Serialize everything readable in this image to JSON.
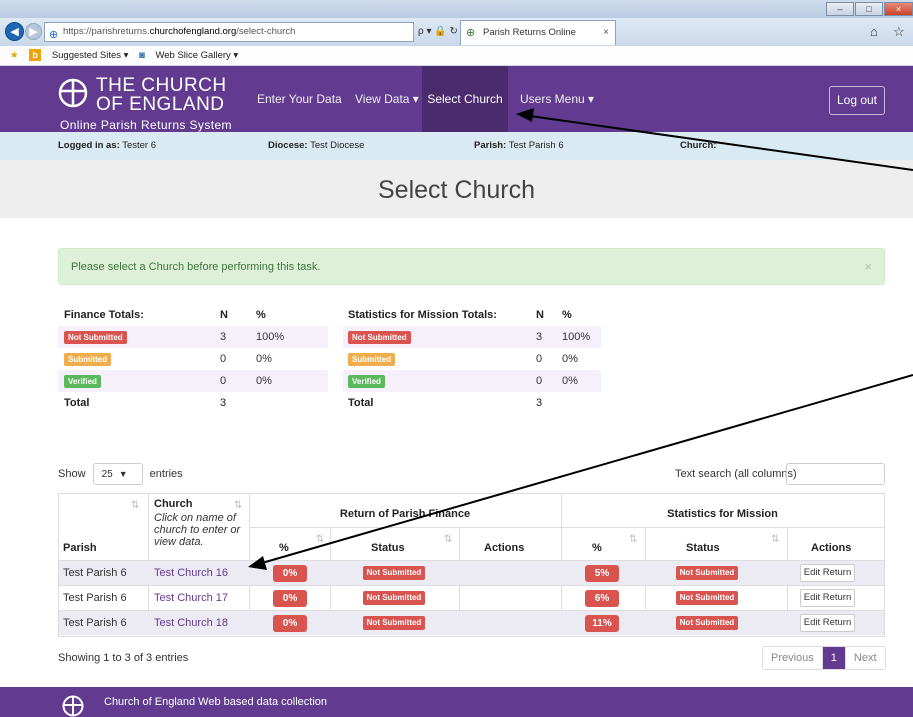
{
  "browser": {
    "url_prefix": "https://parishreturns.",
    "url_domain": "churchofengland.org",
    "url_path": "/select-church",
    "tab_title": "Parish Returns Online",
    "tab_close": "×",
    "address_icons": "ρ ▾ 🔒 ↻",
    "favorites": {
      "suggested": "Suggested Sites ▾",
      "web_slice": "Web Slice Gallery ▾"
    }
  },
  "header": {
    "logo_line1": "THE CHURCH",
    "logo_line2": "OF ENGLAND",
    "logo_sub": "Online Parish Returns System",
    "nav": [
      {
        "label": "Enter Your Data"
      },
      {
        "label": "View Data ▾"
      },
      {
        "label": "Select Church"
      },
      {
        "label": "Users Menu ▾"
      }
    ],
    "logout": "Log out"
  },
  "infobar": {
    "logged_label": "Logged in as:",
    "logged_value": "Tester 6",
    "diocese_label": "Diocese:",
    "diocese_value": "Test Diocese",
    "parish_label": "Parish:",
    "parish_value": "Test Parish 6",
    "church_label": "Church:"
  },
  "page_title": "Select Church",
  "alert": {
    "text": "Please select a Church before performing this task.",
    "close": "×"
  },
  "finance_totals": {
    "title": "Finance Totals:",
    "n_header": "N",
    "pct_header": "%",
    "rows": [
      {
        "status": "Not Submitted",
        "n": "3",
        "pct": "100%"
      },
      {
        "status": "Submitted",
        "n": "0",
        "pct": "0%"
      },
      {
        "status": "Verified",
        "n": "0",
        "pct": "0%"
      }
    ],
    "total_label": "Total",
    "total_n": "3"
  },
  "mission_totals": {
    "title": "Statistics for Mission Totals:",
    "n_header": "N",
    "pct_header": "%",
    "rows": [
      {
        "status": "Not Submitted",
        "n": "3",
        "pct": "100%"
      },
      {
        "status": "Submitted",
        "n": "0",
        "pct": "0%"
      },
      {
        "status": "Verified",
        "n": "0",
        "pct": "0%"
      }
    ],
    "total_label": "Total",
    "total_n": "3"
  },
  "table_controls": {
    "show_label": "Show",
    "page_size": "25",
    "entries_label": "entries",
    "search_label": "Text search (all columns)"
  },
  "table": {
    "headers": {
      "parish": "Parish",
      "church": "Church",
      "church_hint": "Click on name of church to enter or view data.",
      "finance_group": "Return of Parish Finance",
      "mission_group": "Statistics for Mission",
      "pct": "%",
      "status": "Status",
      "actions": "Actions"
    },
    "rows": [
      {
        "parish": "Test Parish 6",
        "church": "Test Church 16",
        "fin_pct": "0%",
        "fin_status": "Not Submitted",
        "mis_pct": "5%",
        "mis_status": "Not Submitted",
        "action": "Edit Return"
      },
      {
        "parish": "Test Parish 6",
        "church": "Test Church 17",
        "fin_pct": "0%",
        "fin_status": "Not Submitted",
        "mis_pct": "6%",
        "mis_status": "Not Submitted",
        "action": "Edit Return"
      },
      {
        "parish": "Test Parish 6",
        "church": "Test Church 18",
        "fin_pct": "0%",
        "fin_status": "Not Submitted",
        "mis_pct": "11%",
        "mis_status": "Not Submitted",
        "action": "Edit Return"
      }
    ]
  },
  "table_footer": {
    "showing": "Showing 1 to 3 of 3 entries",
    "previous": "Previous",
    "current_page": "1",
    "next": "Next"
  },
  "footer": {
    "text": "Church of England Web based data collection"
  },
  "colors": {
    "brand_purple": "#623b90",
    "danger_red": "#d9534f",
    "warning_orange": "#f0ad4e",
    "success_green": "#5cb85c"
  }
}
